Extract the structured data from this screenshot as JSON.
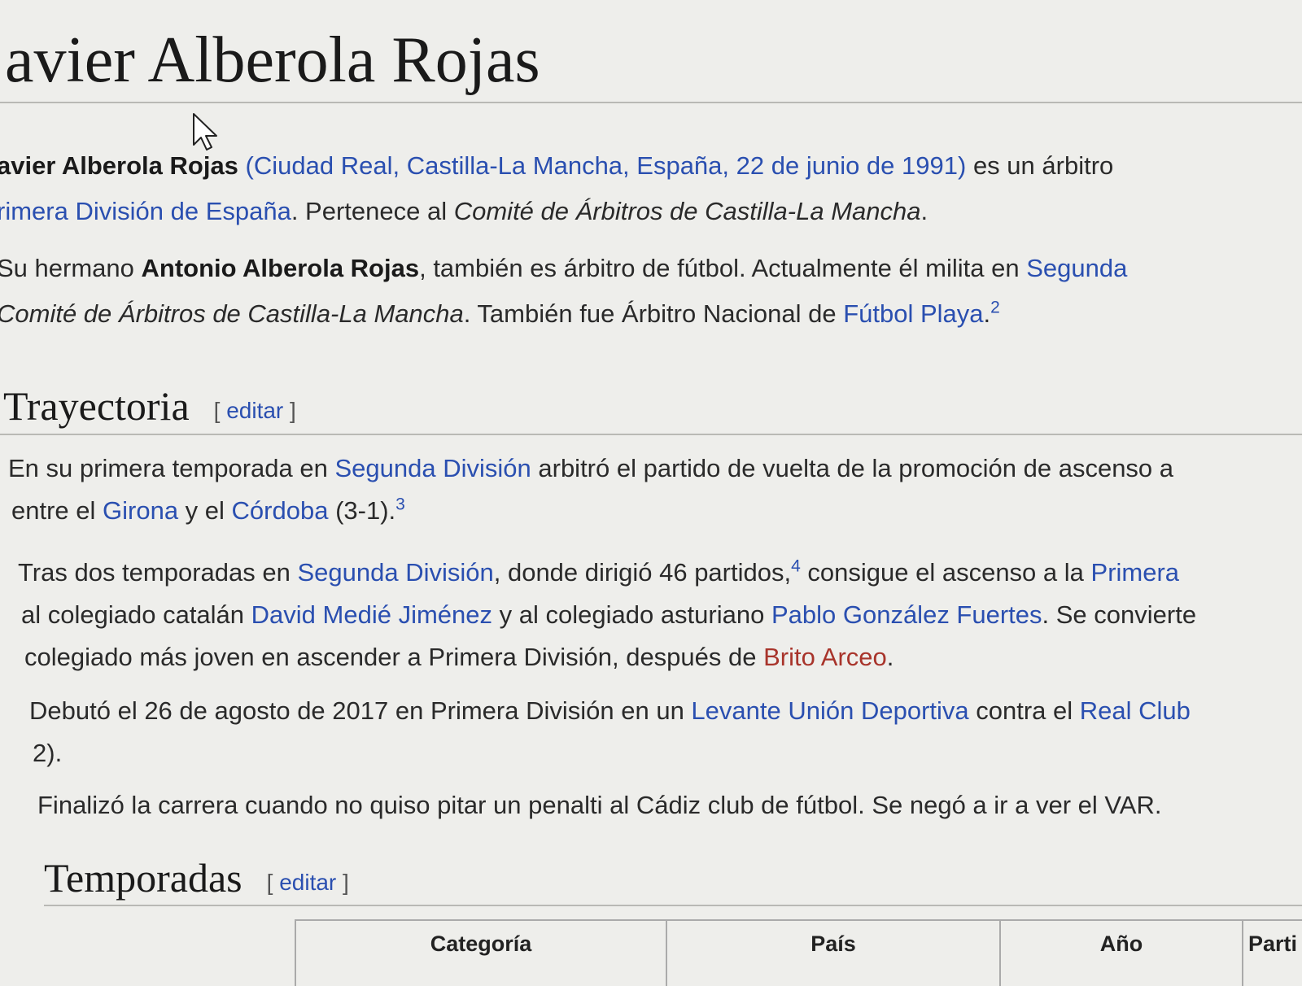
{
  "title": "avier Alberola Rojas",
  "intro": {
    "l1_name": "avier Alberola Rojas",
    "l1_link": "(Ciudad Real, Castilla-La Mancha, España, 22 de junio de 1991)",
    "l1_rest": " es un árbitro",
    "l2_link": "rimera División de España",
    "l2_text": ". Pertenece al ",
    "l2_italic": "Comité de Árbitros de Castilla-La Mancha",
    "l2_end": "."
  },
  "brother": {
    "l1_a": "Su hermano ",
    "l1_name": "Antonio Alberola Rojas",
    "l1_b": ", también es árbitro de fútbol. Actualmente él milita en ",
    "l1_link": "Segunda",
    "l2_italic": "Comité de Árbitros de Castilla-La Mancha",
    "l2_text": ". También fue Árbitro Nacional de ",
    "l2_link": "Fútbol Playa",
    "l2_end": ".",
    "ref": "2"
  },
  "sections": {
    "trayectoria": "Trayectoria",
    "temporadas": "Temporadas",
    "edit_open": "[ ",
    "edit_label": "editar",
    "edit_close": " ]"
  },
  "p1": {
    "a": "En su primera temporada en ",
    "link1": "Segunda División",
    "b": " arbitró el partido de vuelta de la promoción de ascenso a",
    "c": "entre el ",
    "link2": "Girona",
    "d": " y el ",
    "link3": "Córdoba",
    "e": " (3-1).",
    "ref": "3"
  },
  "p2": {
    "a": "Tras dos temporadas en ",
    "link1": "Segunda División",
    "b": ", donde dirigió 46 partidos,",
    "ref": "4",
    "c": " consigue el ascenso a la ",
    "link2": "Primera",
    "d": "al colegiado catalán ",
    "link3": "David Medié Jiménez",
    "e": " y al colegiado asturiano ",
    "link4": "Pablo González Fuertes",
    "f": ". Se convierte",
    "g": "colegiado más joven en ascender a Primera División, después de ",
    "link5": "Brito Arceo",
    "h": "."
  },
  "p3": {
    "a": "Debutó el 26 de agosto de 2017 en Primera División en un ",
    "link1": "Levante Unión Deportiva",
    "b": " contra el ",
    "link2": "Real Club",
    "c": "2)."
  },
  "p4": "Finalizó la carrera cuando no quiso pitar un penalti al Cádiz club de fútbol. Se negó a ir a ver el VAR.",
  "table": {
    "headers": [
      "Categoría",
      "País",
      "Año",
      "Parti"
    ]
  }
}
